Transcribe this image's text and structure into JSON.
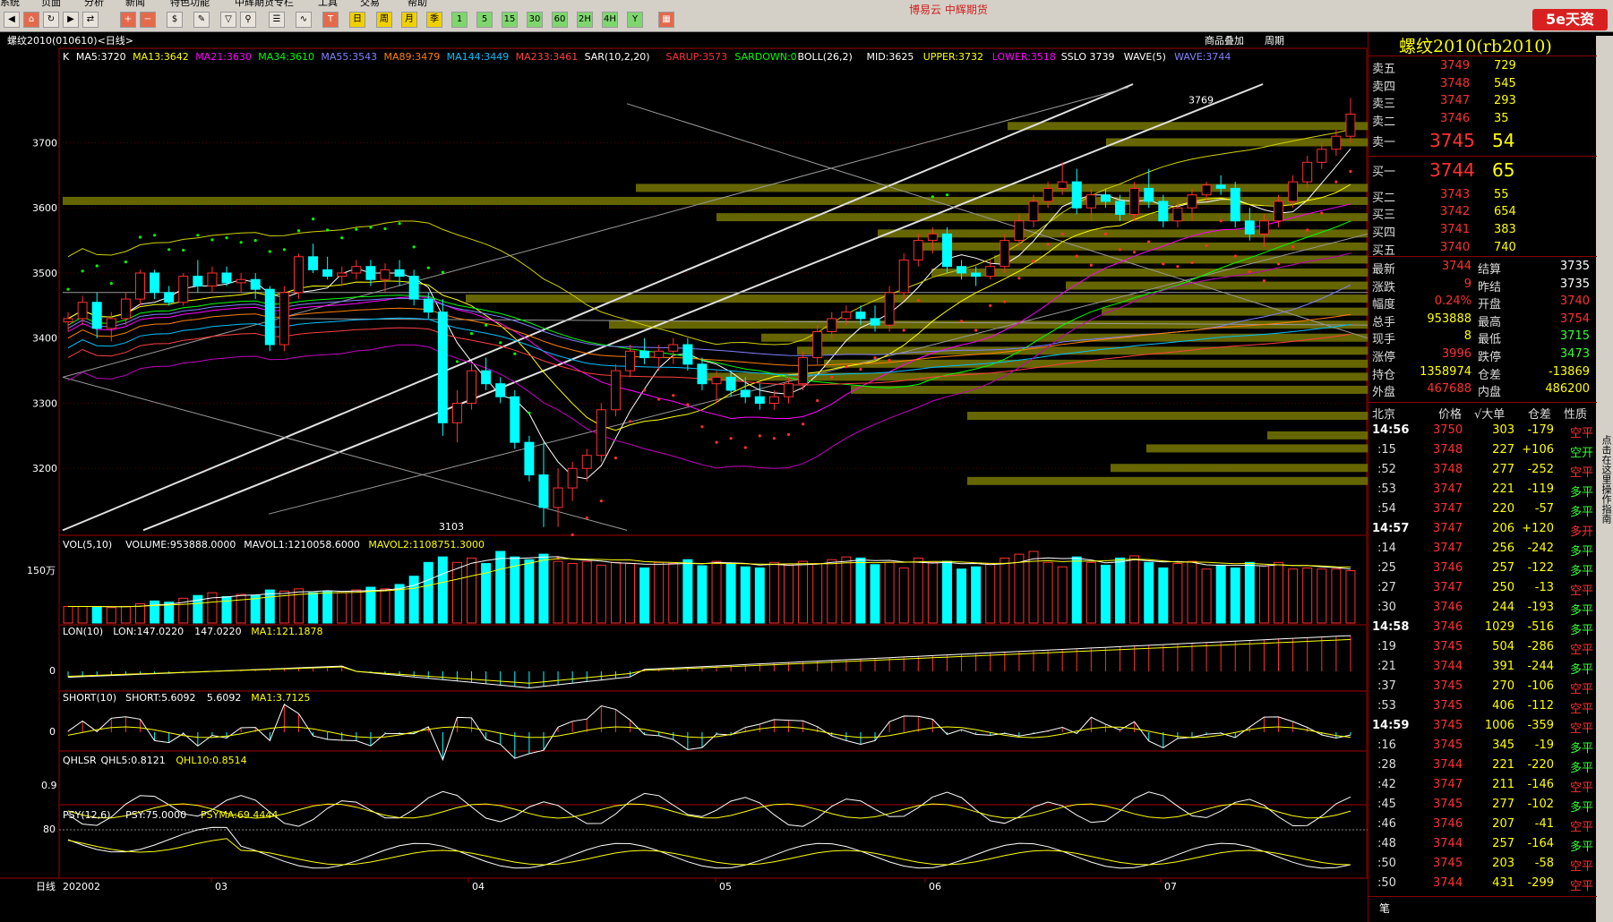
{
  "menu": [
    "系统",
    "页面",
    "分析",
    "新闻",
    "特色功能",
    "中辉期货专栏",
    "工具",
    "交易",
    "帮助"
  ],
  "top_banner": "博易云 中辉期货",
  "brand_logo": "5e天资",
  "right_strip": "点击在这里操作指南",
  "toolbar_period_buttons": [
    "周",
    "月",
    "季",
    "1",
    "5",
    "15",
    "30",
    "60",
    "2H",
    "4H",
    "Y"
  ],
  "chart": {
    "symbol_title": "螺纹2010(010610)<日线>",
    "top_links": [
      "商品叠加",
      "周期"
    ],
    "ma_legend": [
      {
        "text": "K",
        "color": "#ffffff"
      },
      {
        "text": "MA5:3720",
        "color": "#ffffff"
      },
      {
        "text": "MA13:3642",
        "color": "#ffff00"
      },
      {
        "text": "MA21:3630",
        "color": "#ff00ff"
      },
      {
        "text": "MA34:3610",
        "color": "#00ff00"
      },
      {
        "text": "MA55:3543",
        "color": "#8080ff"
      },
      {
        "text": "MA89:3479",
        "color": "#ff8000"
      },
      {
        "text": "MA144:3449",
        "color": "#00c0ff"
      },
      {
        "text": "MA233:3461",
        "color": "#ff4040"
      },
      {
        "text": "SAR(10,2,20)",
        "color": "#ffffff"
      },
      {
        "text": "SARUP:3573",
        "color": "#ff3030"
      },
      {
        "text": "SARDOWN:0",
        "color": "#00ff00"
      },
      {
        "text": "BOLL(26,2)",
        "color": "#ffffff"
      },
      {
        "text": "MID:3625",
        "color": "#ffffff"
      },
      {
        "text": "UPPER:3732",
        "color": "#ffff00"
      },
      {
        "text": "LOWER:3518",
        "color": "#ff00ff"
      },
      {
        "text": "SSLO 3739",
        "color": "#ffffff"
      },
      {
        "text": "WAVE(5)",
        "color": "#ffffff"
      },
      {
        "text": "WAVE:3744",
        "color": "#8080ff"
      }
    ],
    "price_ticks": [
      "3700",
      "3600",
      "3500",
      "3400",
      "3300",
      "3200"
    ],
    "high_label": "3769",
    "low_label": "3103",
    "vol_legend": [
      {
        "text": "VOL(5,10)",
        "color": "#ffffff"
      },
      {
        "text": "VOLUME:953888.0000",
        "color": "#ffffff"
      },
      {
        "text": "MAVOL1:1210058.6000",
        "color": "#ffffff"
      },
      {
        "text": "MAVOL2:1108751.3000",
        "color": "#ffff00"
      }
    ],
    "vol_tick": "150万",
    "lon_legend": [
      {
        "text": "LON(10)",
        "color": "#ffffff"
      },
      {
        "text": "LON:147.0220",
        "color": "#ffffff"
      },
      {
        "text": "147.0220",
        "color": "#ffffff"
      },
      {
        "text": "MA1:121.1878",
        "color": "#ffff00"
      }
    ],
    "lon_tick": "0",
    "short_legend": [
      {
        "text": "SHORT(10)",
        "color": "#ffffff"
      },
      {
        "text": "SHORT:5.6092",
        "color": "#ffffff"
      },
      {
        "text": "5.6092",
        "color": "#ffffff"
      },
      {
        "text": "MA1:3.7125",
        "color": "#ffff00"
      }
    ],
    "short_tick": "0",
    "qhl_legend": [
      {
        "text": "QHLSR",
        "color": "#ffffff"
      },
      {
        "text": "QHL5:0.8121",
        "color": "#ffffff"
      },
      {
        "text": "QHL10:0.8514",
        "color": "#ffff00"
      }
    ],
    "qhl_tick": "0.9",
    "psy_legend": [
      {
        "text": "PSY(12,6)",
        "color": "#ffffff"
      },
      {
        "text": "PSY:75.0000",
        "color": "#ffffff"
      },
      {
        "text": "PSYMA:69.4444",
        "color": "#ffff00"
      }
    ],
    "psy_tick": "80",
    "date_axis": {
      "label": "日线",
      "start": "202002",
      "months": [
        "03",
        "04",
        "05",
        "06",
        "07"
      ]
    }
  },
  "quote": {
    "title": "螺纹2010(rb2010)",
    "asks": [
      {
        "label": "卖五",
        "price": "3749",
        "vol": "729"
      },
      {
        "label": "卖四",
        "price": "3748",
        "vol": "545"
      },
      {
        "label": "卖三",
        "price": "3747",
        "vol": "293"
      },
      {
        "label": "卖二",
        "price": "3746",
        "vol": "35"
      },
      {
        "label": "卖一",
        "price": "3745",
        "vol": "54"
      }
    ],
    "bids": [
      {
        "label": "买一",
        "price": "3744",
        "vol": "65"
      },
      {
        "label": "买二",
        "price": "3743",
        "vol": "55"
      },
      {
        "label": "买三",
        "price": "3742",
        "vol": "654"
      },
      {
        "label": "买四",
        "price": "3741",
        "vol": "383"
      },
      {
        "label": "买五",
        "price": "3740",
        "vol": "740"
      }
    ],
    "stats": [
      {
        "l1": "最新",
        "v1": "3744",
        "c1": "pr",
        "l2": "结算",
        "v2": "3735",
        "c2": "wh"
      },
      {
        "l1": "涨跌",
        "v1": "9",
        "c1": "pr",
        "l2": "昨结",
        "v2": "3735",
        "c2": "wh"
      },
      {
        "l1": "幅度",
        "v1": "0.24%",
        "c1": "pr",
        "l2": "开盘",
        "v2": "3740",
        "c2": "pr"
      },
      {
        "l1": "总手",
        "v1": "953888",
        "c1": "vol",
        "l2": "最高",
        "v2": "3754",
        "c2": "pr"
      },
      {
        "l1": "现手",
        "v1": "8",
        "c1": "vol",
        "l2": "最低",
        "v2": "3715",
        "c2": "gr"
      },
      {
        "l1": "涨停",
        "v1": "3996",
        "c1": "pr",
        "l2": "跌停",
        "v2": "3473",
        "c2": "gr"
      },
      {
        "l1": "持仓",
        "v1": "1358974",
        "c1": "vol",
        "l2": "仓差",
        "v2": "-13869",
        "c2": "vol"
      },
      {
        "l1": "外盘",
        "v1": "467688",
        "c1": "pr",
        "l2": "内盘",
        "v2": "486200",
        "c2": "vol"
      }
    ],
    "tick_header": [
      "北京",
      "价格",
      "√大单",
      "仓差",
      "性质"
    ],
    "ticks": [
      {
        "time": "14:56",
        "price": "3750",
        "vol": "303",
        "oi": "-179",
        "nature": "空平",
        "nc": "r"
      },
      {
        "time": ":15",
        "price": "3748",
        "vol": "227",
        "oi": "+106",
        "nature": "空开",
        "nc": "g"
      },
      {
        "time": ":52",
        "price": "3748",
        "vol": "277",
        "oi": "-252",
        "nature": "空平",
        "nc": "r"
      },
      {
        "time": ":53",
        "price": "3747",
        "vol": "221",
        "oi": "-119",
        "nature": "多平",
        "nc": "g"
      },
      {
        "time": ":54",
        "price": "3747",
        "vol": "220",
        "oi": "-57",
        "nature": "多平",
        "nc": "g"
      },
      {
        "time": "14:57",
        "price": "3747",
        "vol": "206",
        "oi": "+120",
        "nature": "多开",
        "nc": "r"
      },
      {
        "time": ":14",
        "price": "3747",
        "vol": "256",
        "oi": "-242",
        "nature": "多平",
        "nc": "g"
      },
      {
        "time": ":25",
        "price": "3746",
        "vol": "257",
        "oi": "-122",
        "nature": "多平",
        "nc": "g"
      },
      {
        "time": ":27",
        "price": "3747",
        "vol": "250",
        "oi": "-13",
        "nature": "空平",
        "nc": "r"
      },
      {
        "time": ":30",
        "price": "3746",
        "vol": "244",
        "oi": "-193",
        "nature": "多平",
        "nc": "g"
      },
      {
        "time": "14:58",
        "price": "3746",
        "vol": "1029",
        "oi": "-516",
        "nature": "多平",
        "nc": "g"
      },
      {
        "time": ":19",
        "price": "3745",
        "vol": "504",
        "oi": "-286",
        "nature": "空平",
        "nc": "r"
      },
      {
        "time": ":21",
        "price": "3744",
        "vol": "391",
        "oi": "-244",
        "nature": "多平",
        "nc": "g"
      },
      {
        "time": ":37",
        "price": "3745",
        "vol": "270",
        "oi": "-106",
        "nature": "空平",
        "nc": "r"
      },
      {
        "time": ":53",
        "price": "3745",
        "vol": "406",
        "oi": "-112",
        "nature": "空平",
        "nc": "r"
      },
      {
        "time": "14:59",
        "price": "3745",
        "vol": "1006",
        "oi": "-359",
        "nature": "空平",
        "nc": "r"
      },
      {
        "time": ":16",
        "price": "3745",
        "vol": "345",
        "oi": "-19",
        "nature": "多平",
        "nc": "g"
      },
      {
        "time": ":28",
        "price": "3744",
        "vol": "221",
        "oi": "-220",
        "nature": "多平",
        "nc": "g"
      },
      {
        "time": ":42",
        "price": "3747",
        "vol": "211",
        "oi": "-146",
        "nature": "空平",
        "nc": "r"
      },
      {
        "time": ":45",
        "price": "3745",
        "vol": "277",
        "oi": "-102",
        "nature": "多平",
        "nc": "g"
      },
      {
        "time": ":46",
        "price": "3746",
        "vol": "207",
        "oi": "-41",
        "nature": "空平",
        "nc": "r"
      },
      {
        "time": ":48",
        "price": "3744",
        "vol": "257",
        "oi": "-164",
        "nature": "多平",
        "nc": "g"
      },
      {
        "time": ":50",
        "price": "3745",
        "vol": "203",
        "oi": "-58",
        "nature": "空平",
        "nc": "r"
      },
      {
        "time": ":50",
        "price": "3744",
        "vol": "431",
        "oi": "-299",
        "nature": "空平",
        "nc": "r"
      }
    ],
    "footer_tab": "笔"
  },
  "chart_data": {
    "type": "candlestick",
    "price_range": [
      3100,
      3790
    ],
    "bars": [
      [
        3425,
        3440,
        3410,
        3430
      ],
      [
        3430,
        3465,
        3420,
        3455
      ],
      [
        3455,
        3470,
        3400,
        3415
      ],
      [
        3415,
        3440,
        3395,
        3430
      ],
      [
        3430,
        3470,
        3420,
        3460
      ],
      [
        3460,
        3505,
        3450,
        3500
      ],
      [
        3500,
        3505,
        3460,
        3470
      ],
      [
        3470,
        3480,
        3450,
        3455
      ],
      [
        3455,
        3500,
        3450,
        3495
      ],
      [
        3495,
        3520,
        3470,
        3480
      ],
      [
        3480,
        3510,
        3470,
        3500
      ],
      [
        3500,
        3510,
        3480,
        3485
      ],
      [
        3485,
        3500,
        3470,
        3490
      ],
      [
        3490,
        3500,
        3460,
        3475
      ],
      [
        3475,
        3480,
        3380,
        3390
      ],
      [
        3390,
        3480,
        3380,
        3470
      ],
      [
        3470,
        3530,
        3460,
        3525
      ],
      [
        3525,
        3545,
        3500,
        3505
      ],
      [
        3505,
        3525,
        3490,
        3495
      ],
      [
        3495,
        3510,
        3480,
        3500
      ],
      [
        3500,
        3520,
        3490,
        3510
      ],
      [
        3510,
        3520,
        3480,
        3490
      ],
      [
        3490,
        3515,
        3470,
        3505
      ],
      [
        3505,
        3520,
        3480,
        3495
      ],
      [
        3495,
        3505,
        3450,
        3460
      ],
      [
        3460,
        3470,
        3430,
        3440
      ],
      [
        3440,
        3460,
        3250,
        3270
      ],
      [
        3270,
        3320,
        3240,
        3300
      ],
      [
        3300,
        3360,
        3290,
        3350
      ],
      [
        3350,
        3370,
        3320,
        3330
      ],
      [
        3330,
        3340,
        3300,
        3310
      ],
      [
        3310,
        3320,
        3230,
        3240
      ],
      [
        3240,
        3250,
        3180,
        3190
      ],
      [
        3190,
        3240,
        3110,
        3140
      ],
      [
        3140,
        3200,
        3110,
        3170
      ],
      [
        3170,
        3210,
        3150,
        3200
      ],
      [
        3200,
        3230,
        3180,
        3220
      ],
      [
        3220,
        3300,
        3210,
        3290
      ],
      [
        3290,
        3360,
        3280,
        3350
      ],
      [
        3350,
        3390,
        3340,
        3380
      ],
      [
        3380,
        3400,
        3360,
        3370
      ],
      [
        3370,
        3390,
        3350,
        3380
      ],
      [
        3380,
        3400,
        3360,
        3390
      ],
      [
        3390,
        3400,
        3350,
        3360
      ],
      [
        3360,
        3370,
        3320,
        3330
      ],
      [
        3330,
        3350,
        3300,
        3340
      ],
      [
        3340,
        3350,
        3310,
        3320
      ],
      [
        3320,
        3340,
        3300,
        3310
      ],
      [
        3310,
        3330,
        3290,
        3300
      ],
      [
        3300,
        3320,
        3290,
        3310
      ],
      [
        3310,
        3340,
        3300,
        3330
      ],
      [
        3330,
        3380,
        3320,
        3370
      ],
      [
        3370,
        3420,
        3360,
        3410
      ],
      [
        3410,
        3440,
        3400,
        3430
      ],
      [
        3430,
        3450,
        3420,
        3440
      ],
      [
        3440,
        3450,
        3420,
        3430
      ],
      [
        3430,
        3450,
        3410,
        3420
      ],
      [
        3420,
        3480,
        3410,
        3470
      ],
      [
        3470,
        3530,
        3460,
        3520
      ],
      [
        3520,
        3560,
        3510,
        3550
      ],
      [
        3550,
        3570,
        3530,
        3560
      ],
      [
        3560,
        3570,
        3500,
        3510
      ],
      [
        3510,
        3520,
        3490,
        3500
      ],
      [
        3500,
        3510,
        3480,
        3495
      ],
      [
        3495,
        3520,
        3490,
        3510
      ],
      [
        3510,
        3560,
        3500,
        3550
      ],
      [
        3550,
        3590,
        3540,
        3580
      ],
      [
        3580,
        3620,
        3570,
        3610
      ],
      [
        3610,
        3640,
        3600,
        3630
      ],
      [
        3630,
        3670,
        3620,
        3640
      ],
      [
        3640,
        3660,
        3590,
        3600
      ],
      [
        3600,
        3630,
        3580,
        3620
      ],
      [
        3620,
        3630,
        3600,
        3610
      ],
      [
        3610,
        3620,
        3580,
        3590
      ],
      [
        3590,
        3640,
        3580,
        3630
      ],
      [
        3630,
        3660,
        3600,
        3610
      ],
      [
        3610,
        3620,
        3570,
        3580
      ],
      [
        3580,
        3610,
        3570,
        3600
      ],
      [
        3600,
        3630,
        3580,
        3620
      ],
      [
        3620,
        3640,
        3610,
        3635
      ],
      [
        3635,
        3650,
        3620,
        3630
      ],
      [
        3630,
        3640,
        3570,
        3580
      ],
      [
        3580,
        3600,
        3550,
        3560
      ],
      [
        3560,
        3590,
        3540,
        3580
      ],
      [
        3580,
        3620,
        3570,
        3610
      ],
      [
        3610,
        3650,
        3600,
        3640
      ],
      [
        3640,
        3680,
        3630,
        3670
      ],
      [
        3670,
        3700,
        3660,
        3690
      ],
      [
        3690,
        3720,
        3680,
        3710
      ],
      [
        3710,
        3769,
        3700,
        3744
      ]
    ],
    "volumes": [
      30,
      30,
      30,
      28,
      30,
      35,
      40,
      38,
      45,
      50,
      55,
      48,
      52,
      50,
      60,
      58,
      62,
      55,
      58,
      55,
      60,
      65,
      62,
      70,
      85,
      110,
      120,
      110,
      118,
      108,
      130,
      120,
      115,
      125,
      112,
      108,
      112,
      105,
      110,
      108,
      100,
      110,
      108,
      115,
      104,
      112,
      108,
      102,
      100,
      110,
      105,
      112,
      108,
      115,
      120,
      118,
      106,
      110,
      100,
      118,
      110,
      112,
      98,
      102,
      108,
      118,
      125,
      130,
      110,
      102,
      120,
      110,
      105,
      118,
      122,
      110,
      100,
      108,
      112,
      98,
      105,
      100,
      110,
      104,
      110,
      98,
      100,
      98,
      98,
      95
    ]
  }
}
